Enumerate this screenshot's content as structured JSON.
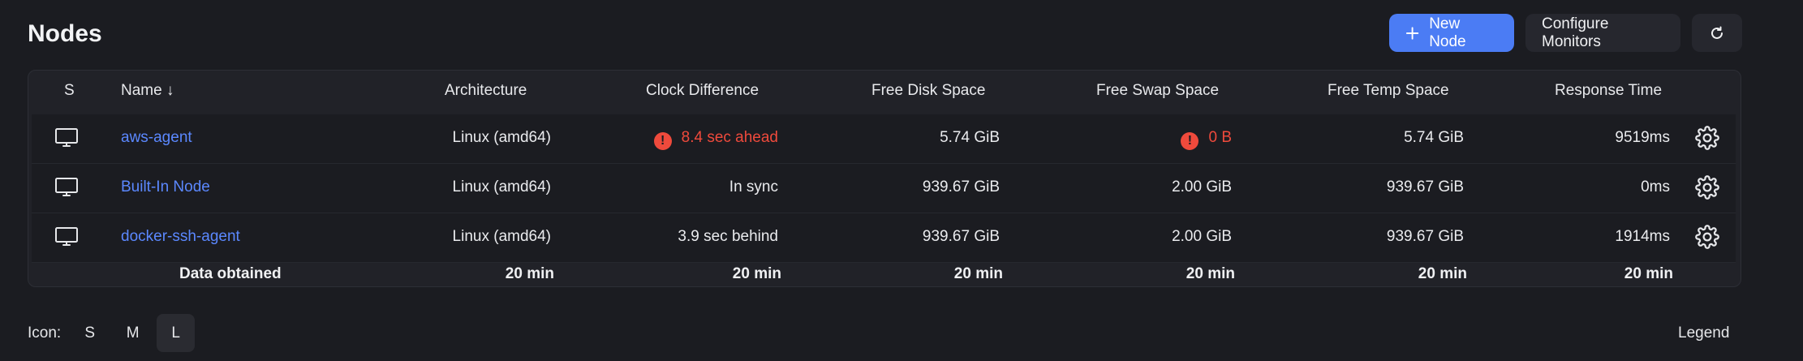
{
  "page": {
    "title": "Nodes"
  },
  "toolbar": {
    "new_node_label": "New Node",
    "configure_monitors_label": "Configure Monitors",
    "refresh_icon": "refresh-icon"
  },
  "table": {
    "columns": [
      "S",
      "Name  ↓",
      "Architecture",
      "Clock Difference",
      "Free Disk Space",
      "Free Swap Space",
      "Free Temp Space",
      "Response Time"
    ],
    "rows": [
      {
        "name": "aws-agent",
        "architecture": "Linux (amd64)",
        "clock_difference": "8.4 sec ahead",
        "clock_warning": true,
        "free_disk": "5.74 GiB",
        "free_swap": "0 B",
        "swap_warning": true,
        "free_temp": "5.74 GiB",
        "response_time": "9519ms"
      },
      {
        "name": "Built-In Node",
        "architecture": "Linux (amd64)",
        "clock_difference": "In sync",
        "clock_warning": false,
        "free_disk": "939.67 GiB",
        "free_swap": "2.00 GiB",
        "swap_warning": false,
        "free_temp": "939.67 GiB",
        "response_time": "0ms"
      },
      {
        "name": "docker-ssh-agent",
        "architecture": "Linux (amd64)",
        "clock_difference": "3.9 sec behind",
        "clock_warning": false,
        "free_disk": "939.67 GiB",
        "free_swap": "2.00 GiB",
        "swap_warning": false,
        "free_temp": "939.67 GiB",
        "response_time": "1914ms"
      }
    ],
    "footer": {
      "label": "Data obtained",
      "architecture": "20 min",
      "clock_difference": "20 min",
      "free_disk": "20 min",
      "free_swap": "20 min",
      "free_temp": "20 min",
      "response_time": "20 min"
    }
  },
  "icon_size": {
    "label": "Icon:",
    "options": [
      "S",
      "M",
      "L"
    ],
    "selected": "L"
  },
  "legend_label": "Legend",
  "colors": {
    "accent": "#4b7cf4",
    "link": "#5b88ff",
    "warning": "#ef4a3c",
    "background": "#1b1c21"
  }
}
